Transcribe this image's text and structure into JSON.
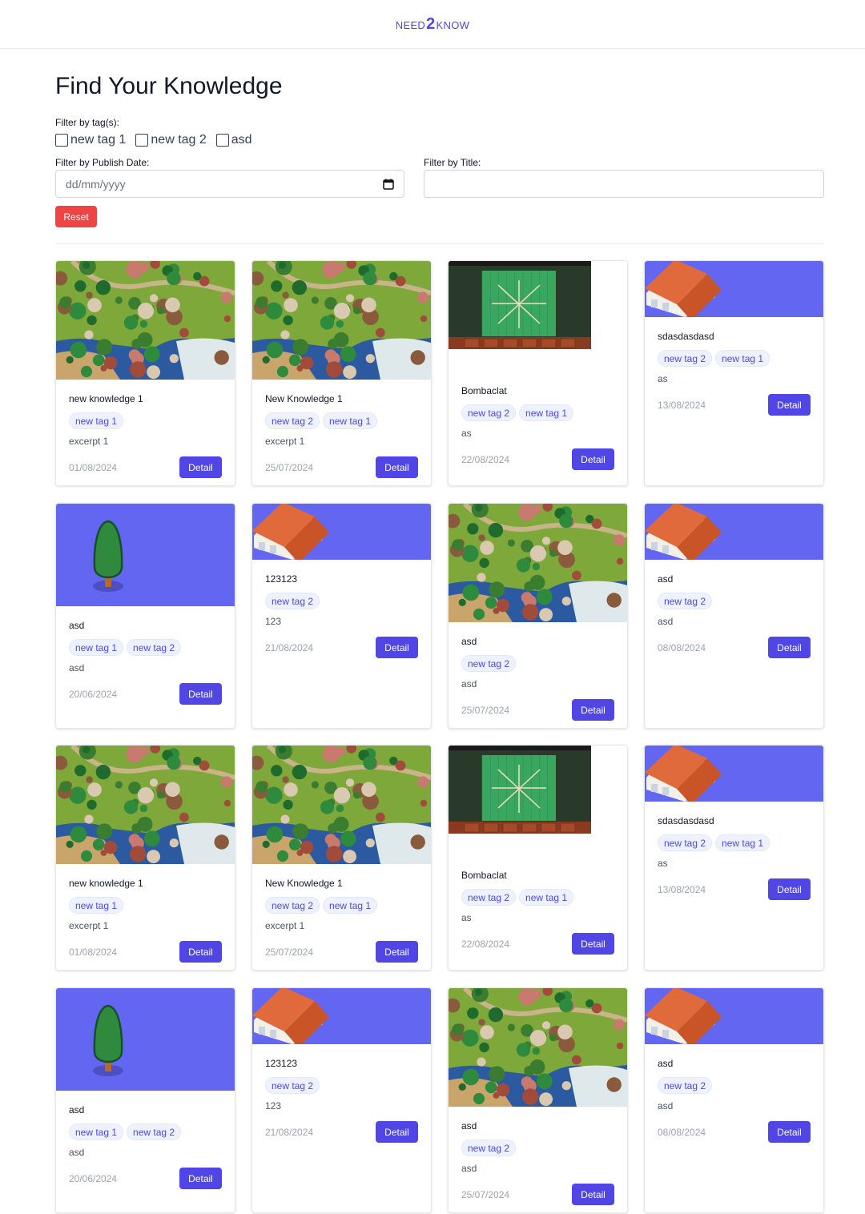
{
  "app": {
    "logo_pre": "NEED",
    "logo_num": "2",
    "logo_post": "KNOW"
  },
  "filters": {
    "title": "Find Your Knowledge",
    "tags_label": "Filter by tag(s):",
    "tags": [
      "new tag 1",
      "new tag 2",
      "asd"
    ],
    "date_label": "Filter by Publish Date:",
    "date_placeholder": "dd/mm/yyyy",
    "title_label": "Filter by Title:",
    "title_value": "",
    "reset_label": "Reset"
  },
  "detail_label": "Detail",
  "colors": {
    "accent": "#4f46e5",
    "reset": "#ef4444",
    "image_bg": "#6366f1"
  },
  "cards": [
    {
      "image": "forest-map",
      "title": "new knowledge 1",
      "tags": [
        "new tag 1"
      ],
      "excerpt": "excerpt 1",
      "date": "01/08/2024"
    },
    {
      "image": "forest-map",
      "title": "New Knowledge 1",
      "tags": [
        "new tag 2",
        "new tag 1"
      ],
      "excerpt": "excerpt 1",
      "date": "25/07/2024"
    },
    {
      "image": "game-screenshot",
      "title": "Bombaclat",
      "tags": [
        "new tag 2",
        "new tag 1"
      ],
      "excerpt": "as",
      "date": "22/08/2024"
    },
    {
      "image": "house",
      "title": "sdasdasdasd",
      "tags": [
        "new tag 2",
        "new tag 1"
      ],
      "excerpt": "as",
      "date": "13/08/2024"
    },
    {
      "image": "tree",
      "title": "asd",
      "tags": [
        "new tag 1",
        "new tag 2"
      ],
      "excerpt": "asd",
      "date": "20/06/2024"
    },
    {
      "image": "house",
      "title": "123123",
      "tags": [
        "new tag 2"
      ],
      "excerpt": "123",
      "date": "21/08/2024"
    },
    {
      "image": "forest-map",
      "title": "asd",
      "tags": [
        "new tag 2"
      ],
      "excerpt": "asd",
      "date": "25/07/2024"
    },
    {
      "image": "house",
      "title": "asd",
      "tags": [
        "new tag 2"
      ],
      "excerpt": "asd",
      "date": "08/08/2024"
    },
    {
      "image": "forest-map",
      "title": "new knowledge 1",
      "tags": [
        "new tag 1"
      ],
      "excerpt": "excerpt 1",
      "date": "01/08/2024"
    },
    {
      "image": "forest-map",
      "title": "New Knowledge 1",
      "tags": [
        "new tag 2",
        "new tag 1"
      ],
      "excerpt": "excerpt 1",
      "date": "25/07/2024"
    },
    {
      "image": "game-screenshot",
      "title": "Bombaclat",
      "tags": [
        "new tag 2",
        "new tag 1"
      ],
      "excerpt": "as",
      "date": "22/08/2024"
    },
    {
      "image": "house",
      "title": "sdasdasdasd",
      "tags": [
        "new tag 2",
        "new tag 1"
      ],
      "excerpt": "as",
      "date": "13/08/2024"
    },
    {
      "image": "tree",
      "title": "asd",
      "tags": [
        "new tag 1",
        "new tag 2"
      ],
      "excerpt": "asd",
      "date": "20/06/2024"
    },
    {
      "image": "house",
      "title": "123123",
      "tags": [
        "new tag 2"
      ],
      "excerpt": "123",
      "date": "21/08/2024"
    },
    {
      "image": "forest-map",
      "title": "asd",
      "tags": [
        "new tag 2"
      ],
      "excerpt": "asd",
      "date": "25/07/2024"
    },
    {
      "image": "house",
      "title": "asd",
      "tags": [
        "new tag 2"
      ],
      "excerpt": "asd",
      "date": "08/08/2024"
    }
  ]
}
